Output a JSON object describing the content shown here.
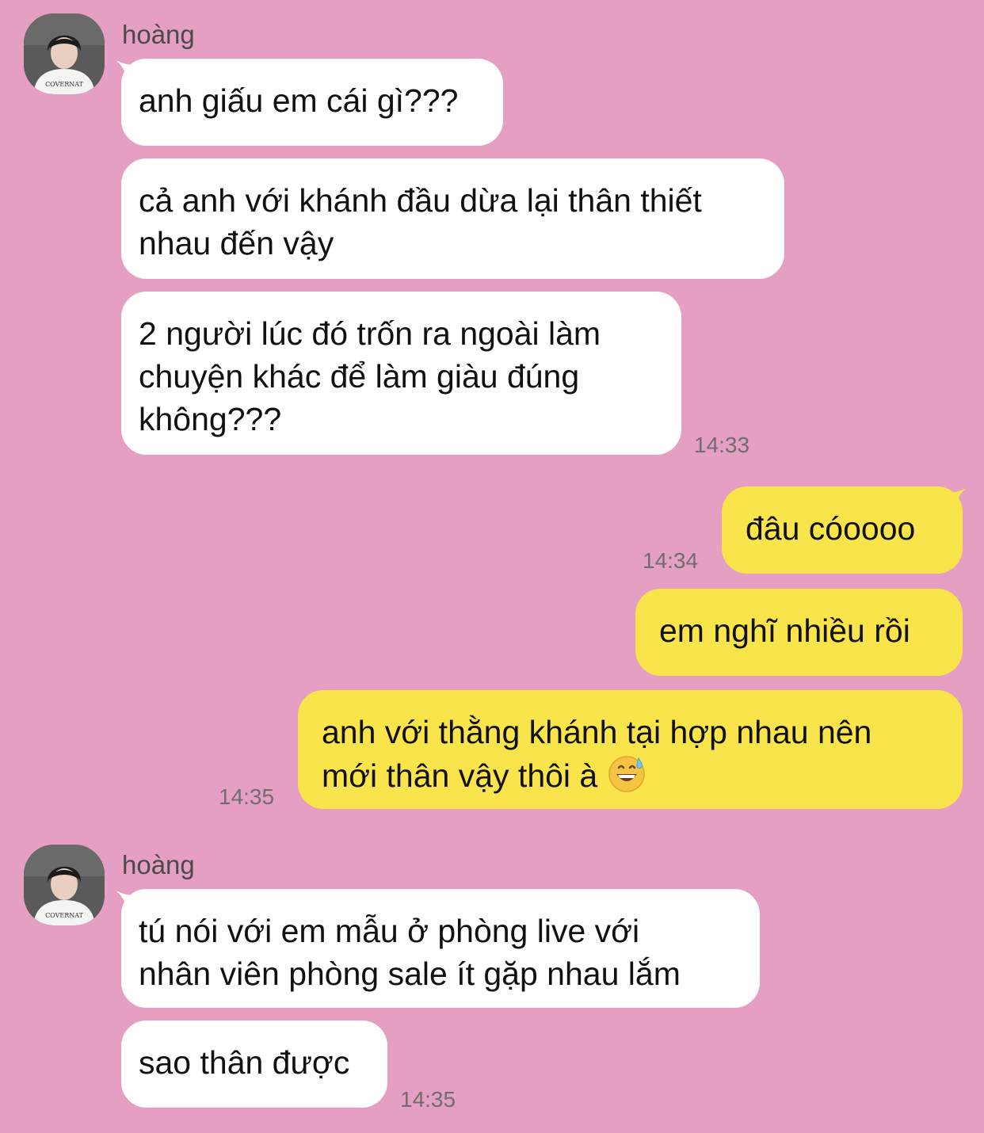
{
  "colors": {
    "background": "#e59fc2",
    "incoming_bubble": "#ffffff",
    "outgoing_bubble": "#f9e54b",
    "timestamp": "#6e6e6e"
  },
  "groups": [
    {
      "sender": "hoàng",
      "avatar_icon": "profile-photo-icon",
      "avatar_caption": "COVERNAT",
      "messages": [
        {
          "text": "anh giấu em cái gì???"
        },
        {
          "text": "cả anh với khánh đầu dừa lại thân thiết\nnhau đến vậy"
        },
        {
          "text": "2 người lúc đó trốn ra ngoài làm\nchuyện khác để làm giàu đúng\nkhông???"
        }
      ],
      "time": "14:33"
    },
    {
      "messages": [
        {
          "text": "đâu cóoooo",
          "time": "14:34"
        },
        {
          "text": "em nghĩ nhiều rồi"
        },
        {
          "text": "anh với thằng khánh tại hợp nhau nên\nmới thân vậy thôi à",
          "emoji": "grinning-sweat-emoji"
        }
      ],
      "time": "14:35"
    },
    {
      "sender": "hoàng",
      "avatar_icon": "profile-photo-icon",
      "avatar_caption": "COVERNAT",
      "messages": [
        {
          "text": "tú nói với em mẫu ở phòng live với\nnhân viên phòng sale ít gặp nhau lắm"
        },
        {
          "text": "sao thân được"
        }
      ],
      "time": "14:35"
    }
  ]
}
